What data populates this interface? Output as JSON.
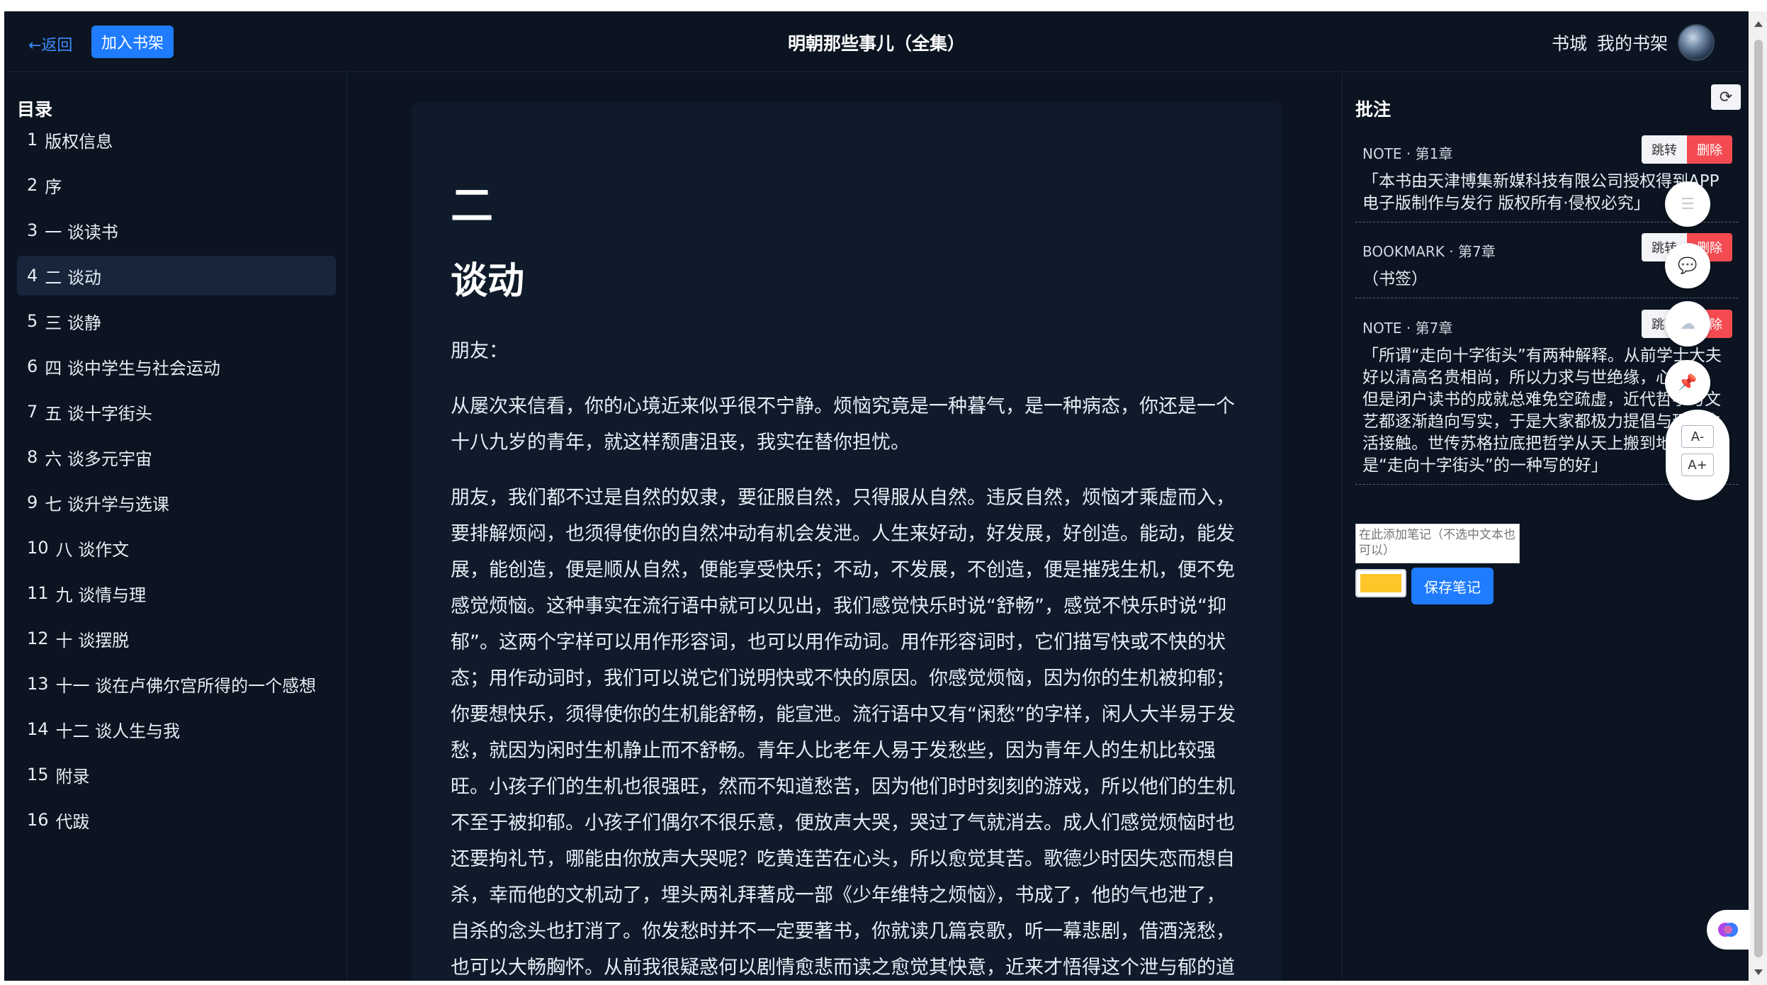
{
  "header": {
    "back_label": "←返回",
    "add_shelf_label": "加入书架",
    "book_title": "明朝那些事儿（全集）",
    "store_label": "书城",
    "my_shelf_label": "我的书架"
  },
  "toc": {
    "title": "目录",
    "items": [
      {
        "num": "1",
        "label": "版权信息"
      },
      {
        "num": "2",
        "label": "序"
      },
      {
        "num": "3",
        "label": "一 谈读书"
      },
      {
        "num": "4",
        "label": "二 谈动"
      },
      {
        "num": "5",
        "label": "三 谈静"
      },
      {
        "num": "6",
        "label": "四 谈中学生与社会运动"
      },
      {
        "num": "7",
        "label": "五 谈十字街头"
      },
      {
        "num": "8",
        "label": "六 谈多元宇宙"
      },
      {
        "num": "9",
        "label": "七 谈升学与选课"
      },
      {
        "num": "10",
        "label": "八 谈作文"
      },
      {
        "num": "11",
        "label": "九 谈情与理"
      },
      {
        "num": "12",
        "label": "十 谈摆脱"
      },
      {
        "num": "13",
        "label": "十一 谈在卢佛尔宫所得的一个感想"
      },
      {
        "num": "14",
        "label": "十二 谈人生与我"
      },
      {
        "num": "15",
        "label": "附录"
      },
      {
        "num": "16",
        "label": "代跋"
      }
    ]
  },
  "reader": {
    "chapter_number": "二",
    "chapter_title": "谈动",
    "paragraphs": [
      "朋友：",
      "从屡次来信看，你的心境近来似乎很不宁静。烦恼究竟是一种暮气，是一种病态，你还是一个十八九岁的青年，就这样颓唐沮丧，我实在替你担忧。",
      "朋友，我们都不过是自然的奴隶，要征服自然，只得服从自然。违反自然，烦恼才乘虚而入，要排解烦闷，也须得使你的自然冲动有机会发泄。人生来好动，好发展，好创造。能动，能发展，能创造，便是顺从自然，便能享受快乐；不动，不发展，不创造，便是摧残生机，便不免感觉烦恼。这种事实在流行语中就可以见出，我们感觉快乐时说“舒畅”，感觉不快乐时说“抑郁”。这两个字样可以用作形容词，也可以用作动词。用作形容词时，它们描写快或不快的状态；用作动词时，我们可以说它们说明快或不快的原因。你感觉烦恼，因为你的生机被抑郁；你要想快乐，须得使你的生机能舒畅，能宣泄。流行语中又有“闲愁”的字样，闲人大半易于发愁，就因为闲时生机静止而不舒畅。青年人比老年人易于发愁些，因为青年人的生机比较强旺。小孩子们的生机也很强旺，然而不知道愁苦，因为他们时时刻刻的游戏，所以他们的生机不至于被抑郁。小孩子们偶尔不很乐意，便放声大哭，哭过了气就消去。成人们感觉烦恼时也还要拘礼节，哪能由你放声大哭呢？吃黄连苦在心头，所以愈觉其苦。歌德少时因失恋而想自杀，幸而他的文机动了，埋头两礼拜著成一部《少年维特之烦恼》，书成了，他的气也泄了，自杀的念头也打消了。你发愁时并不一定要著书，你就读几篇哀歌，听一幕悲剧，借酒浇愁，也可以大畅胸怀。从前我很疑惑何以剧情愈悲而读之愈觉其快意，近来才悟得这个泄与郁的道"
    ]
  },
  "notes": {
    "title": "批注",
    "jump_label": "跳转",
    "delete_label": "删除",
    "items": [
      {
        "type": "NOTE",
        "chapter": "第1章",
        "text": "「本书由天津博集新媒科技有限公司授权得到APP电子版制作与发行 版权所有·侵权必究」"
      },
      {
        "type": "BOOKMARK",
        "chapter": "第7章",
        "text": "（书签）"
      },
      {
        "type": "NOTE",
        "chapter": "第7章",
        "text": "「所谓“走向十字街头”有两种解释。从前学士大夫好以清高名贵相尚，所以力求与世绝缘，心孤往。但是闭户读书的成就总难免空疏虚，近代哲学与文艺都逐渐趋向写实，于是大家都极力提倡与现实生活接触。世传苏格拉底把哲学从天上搬到地下，这是“走向十字街头”的一种写的好」"
      }
    ],
    "input_placeholder": "在此添加笔记（不选中文本也可以）",
    "save_label": "保存笔记",
    "highlight_color": "#ffc629"
  },
  "toolbar": {
    "font_smaller": "A-",
    "font_larger": "A+"
  },
  "colors": {
    "accent": "#1f7cff",
    "danger": "#f44b52",
    "background": "#0b1420",
    "reader_bg": "#0f1b2a"
  }
}
